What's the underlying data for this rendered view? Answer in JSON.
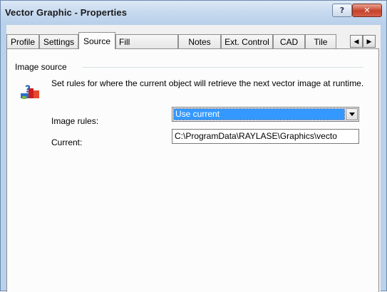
{
  "window": {
    "title": "Vector Graphic - Properties",
    "help_label": "?",
    "close_label": "✕"
  },
  "tabs": [
    {
      "label": "Profile"
    },
    {
      "label": "Settings"
    },
    {
      "label": "Source",
      "active": true
    },
    {
      "label": "Fill"
    },
    {
      "label": "Notes"
    },
    {
      "label": "Ext. Control"
    },
    {
      "label": "CAD"
    },
    {
      "label": "Tile"
    }
  ],
  "tab_scroll": {
    "left": "◀",
    "right": "▶"
  },
  "source": {
    "group_label": "Image source",
    "icon": "info-help-icon",
    "description": "Set rules for where the current object will retrieve the next vector image at runtime.",
    "image_rules_label": "Image rules:",
    "image_rules_value": "Use current",
    "current_label": "Current:",
    "current_value": "C:\\ProgramData\\RAYLASE\\Graphics\\vecto"
  },
  "colors": {
    "selection": "#3399ff",
    "close_button": "#c7412a"
  }
}
